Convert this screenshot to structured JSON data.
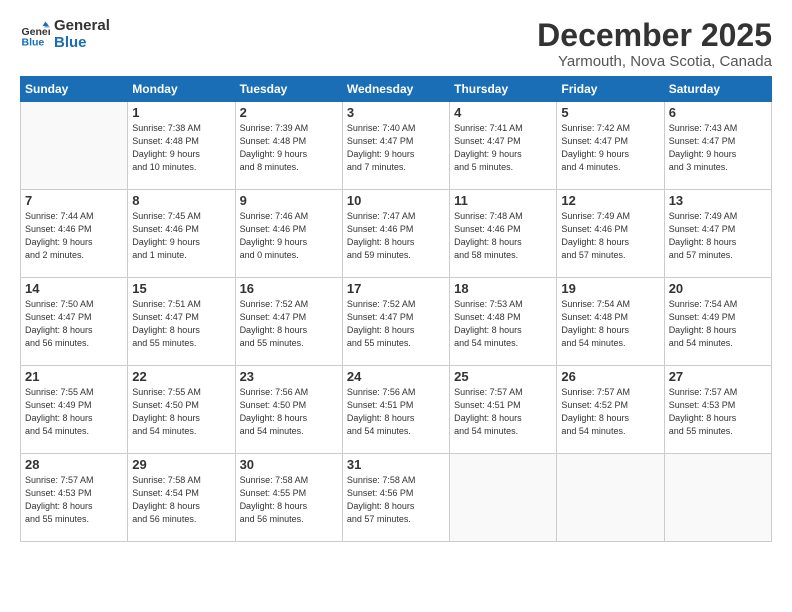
{
  "logo": {
    "line1": "General",
    "line2": "Blue"
  },
  "title": "December 2025",
  "subtitle": "Yarmouth, Nova Scotia, Canada",
  "header_days": [
    "Sunday",
    "Monday",
    "Tuesday",
    "Wednesday",
    "Thursday",
    "Friday",
    "Saturday"
  ],
  "weeks": [
    [
      {
        "day": "",
        "info": ""
      },
      {
        "day": "1",
        "info": "Sunrise: 7:38 AM\nSunset: 4:48 PM\nDaylight: 9 hours\nand 10 minutes."
      },
      {
        "day": "2",
        "info": "Sunrise: 7:39 AM\nSunset: 4:48 PM\nDaylight: 9 hours\nand 8 minutes."
      },
      {
        "day": "3",
        "info": "Sunrise: 7:40 AM\nSunset: 4:47 PM\nDaylight: 9 hours\nand 7 minutes."
      },
      {
        "day": "4",
        "info": "Sunrise: 7:41 AM\nSunset: 4:47 PM\nDaylight: 9 hours\nand 5 minutes."
      },
      {
        "day": "5",
        "info": "Sunrise: 7:42 AM\nSunset: 4:47 PM\nDaylight: 9 hours\nand 4 minutes."
      },
      {
        "day": "6",
        "info": "Sunrise: 7:43 AM\nSunset: 4:47 PM\nDaylight: 9 hours\nand 3 minutes."
      }
    ],
    [
      {
        "day": "7",
        "info": "Sunrise: 7:44 AM\nSunset: 4:46 PM\nDaylight: 9 hours\nand 2 minutes."
      },
      {
        "day": "8",
        "info": "Sunrise: 7:45 AM\nSunset: 4:46 PM\nDaylight: 9 hours\nand 1 minute."
      },
      {
        "day": "9",
        "info": "Sunrise: 7:46 AM\nSunset: 4:46 PM\nDaylight: 9 hours\nand 0 minutes."
      },
      {
        "day": "10",
        "info": "Sunrise: 7:47 AM\nSunset: 4:46 PM\nDaylight: 8 hours\nand 59 minutes."
      },
      {
        "day": "11",
        "info": "Sunrise: 7:48 AM\nSunset: 4:46 PM\nDaylight: 8 hours\nand 58 minutes."
      },
      {
        "day": "12",
        "info": "Sunrise: 7:49 AM\nSunset: 4:46 PM\nDaylight: 8 hours\nand 57 minutes."
      },
      {
        "day": "13",
        "info": "Sunrise: 7:49 AM\nSunset: 4:47 PM\nDaylight: 8 hours\nand 57 minutes."
      }
    ],
    [
      {
        "day": "14",
        "info": "Sunrise: 7:50 AM\nSunset: 4:47 PM\nDaylight: 8 hours\nand 56 minutes."
      },
      {
        "day": "15",
        "info": "Sunrise: 7:51 AM\nSunset: 4:47 PM\nDaylight: 8 hours\nand 55 minutes."
      },
      {
        "day": "16",
        "info": "Sunrise: 7:52 AM\nSunset: 4:47 PM\nDaylight: 8 hours\nand 55 minutes."
      },
      {
        "day": "17",
        "info": "Sunrise: 7:52 AM\nSunset: 4:47 PM\nDaylight: 8 hours\nand 55 minutes."
      },
      {
        "day": "18",
        "info": "Sunrise: 7:53 AM\nSunset: 4:48 PM\nDaylight: 8 hours\nand 54 minutes."
      },
      {
        "day": "19",
        "info": "Sunrise: 7:54 AM\nSunset: 4:48 PM\nDaylight: 8 hours\nand 54 minutes."
      },
      {
        "day": "20",
        "info": "Sunrise: 7:54 AM\nSunset: 4:49 PM\nDaylight: 8 hours\nand 54 minutes."
      }
    ],
    [
      {
        "day": "21",
        "info": "Sunrise: 7:55 AM\nSunset: 4:49 PM\nDaylight: 8 hours\nand 54 minutes."
      },
      {
        "day": "22",
        "info": "Sunrise: 7:55 AM\nSunset: 4:50 PM\nDaylight: 8 hours\nand 54 minutes."
      },
      {
        "day": "23",
        "info": "Sunrise: 7:56 AM\nSunset: 4:50 PM\nDaylight: 8 hours\nand 54 minutes."
      },
      {
        "day": "24",
        "info": "Sunrise: 7:56 AM\nSunset: 4:51 PM\nDaylight: 8 hours\nand 54 minutes."
      },
      {
        "day": "25",
        "info": "Sunrise: 7:57 AM\nSunset: 4:51 PM\nDaylight: 8 hours\nand 54 minutes."
      },
      {
        "day": "26",
        "info": "Sunrise: 7:57 AM\nSunset: 4:52 PM\nDaylight: 8 hours\nand 54 minutes."
      },
      {
        "day": "27",
        "info": "Sunrise: 7:57 AM\nSunset: 4:53 PM\nDaylight: 8 hours\nand 55 minutes."
      }
    ],
    [
      {
        "day": "28",
        "info": "Sunrise: 7:57 AM\nSunset: 4:53 PM\nDaylight: 8 hours\nand 55 minutes."
      },
      {
        "day": "29",
        "info": "Sunrise: 7:58 AM\nSunset: 4:54 PM\nDaylight: 8 hours\nand 56 minutes."
      },
      {
        "day": "30",
        "info": "Sunrise: 7:58 AM\nSunset: 4:55 PM\nDaylight: 8 hours\nand 56 minutes."
      },
      {
        "day": "31",
        "info": "Sunrise: 7:58 AM\nSunset: 4:56 PM\nDaylight: 8 hours\nand 57 minutes."
      },
      {
        "day": "",
        "info": ""
      },
      {
        "day": "",
        "info": ""
      },
      {
        "day": "",
        "info": ""
      }
    ]
  ]
}
